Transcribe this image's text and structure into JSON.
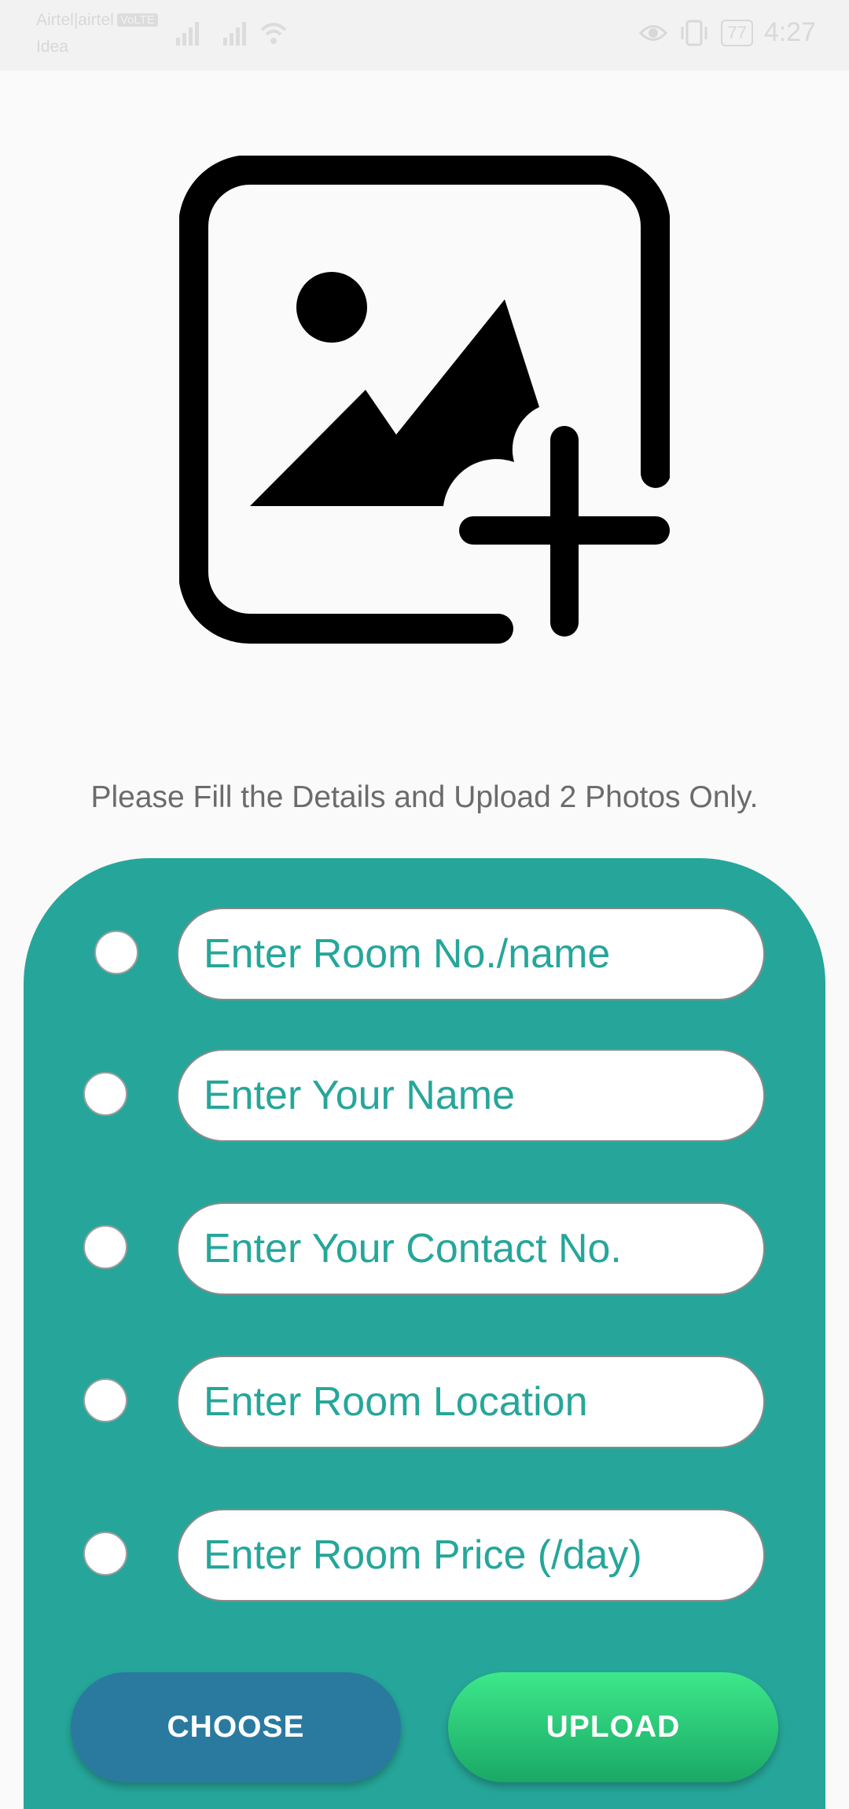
{
  "status_bar": {
    "carrier_primary": "Airtel|airtel",
    "volte_badge": "VoLTE",
    "carrier_secondary": "Idea",
    "battery": "77",
    "time": "4:27"
  },
  "hero_icon": "add-photo-icon",
  "instructions": "Please Fill the Details and Upload 2 Photos Only.",
  "form": {
    "fields": [
      {
        "placeholder": "Enter Room No./name"
      },
      {
        "placeholder": "Enter Your Name"
      },
      {
        "placeholder": "Enter Your Contact No."
      },
      {
        "placeholder": "Enter Room Location"
      },
      {
        "placeholder": "Enter Room Price (/day)"
      }
    ]
  },
  "buttons": {
    "choose": "CHOOSE",
    "upload": "UPLOAD"
  },
  "colors": {
    "card": "#26a69a",
    "choose": "#2a7aa0",
    "upload": "#2ecf7a"
  }
}
